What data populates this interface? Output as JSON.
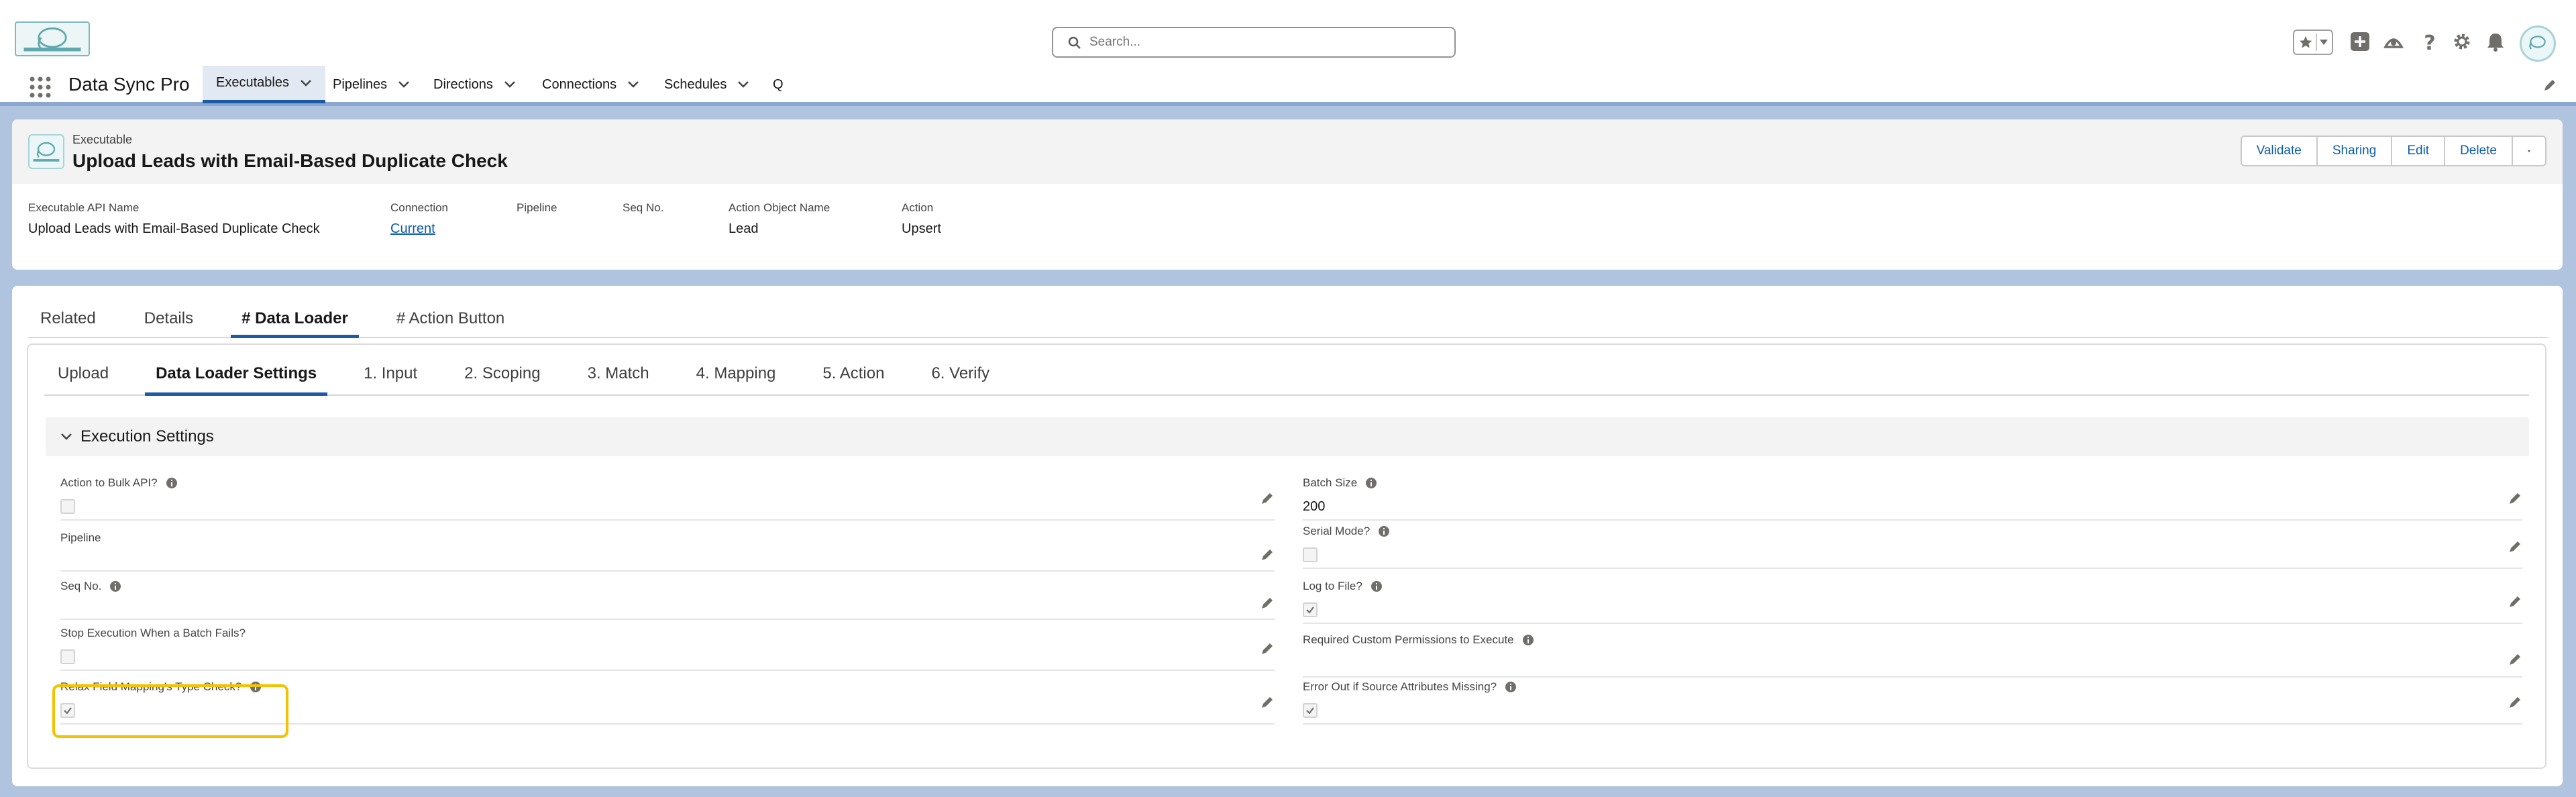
{
  "global_header": {
    "search_placeholder": "Search...",
    "icons": [
      "favorites-star-icon",
      "favorites-dropdown-icon",
      "add-icon",
      "trailhead-icon",
      "help-icon",
      "setup-gear-icon",
      "notifications-bell-icon",
      "avatar"
    ]
  },
  "app_nav": {
    "app_name": "Data Sync Pro",
    "tabs": [
      {
        "label": "Executables",
        "active": true
      },
      {
        "label": "Pipelines"
      },
      {
        "label": "Directions"
      },
      {
        "label": "Connections"
      },
      {
        "label": "Schedules"
      },
      {
        "label": "Q"
      }
    ]
  },
  "record": {
    "type": "Executable",
    "title": "Upload Leads with Email-Based Duplicate Check",
    "actions": [
      "Validate",
      "Sharing",
      "Edit",
      "Delete"
    ],
    "highlights": [
      {
        "label": "Executable API Name",
        "value": "Upload Leads with Email-Based Duplicate Check"
      },
      {
        "label": "Connection",
        "value": "Current"
      },
      {
        "label": "Pipeline",
        "value": ""
      },
      {
        "label": "Seq No.",
        "value": ""
      },
      {
        "label": "Action Object Name",
        "value": "Lead"
      },
      {
        "label": "Action",
        "value": "Upsert"
      }
    ]
  },
  "main_tabs": [
    {
      "label": "Related"
    },
    {
      "label": "Details"
    },
    {
      "label": "# Data Loader",
      "active": true
    },
    {
      "label": "# Action Button"
    }
  ],
  "sub_tabs": [
    {
      "label": "Upload"
    },
    {
      "label": "Data Loader Settings",
      "active": true
    },
    {
      "label": "1. Input"
    },
    {
      "label": "2. Scoping"
    },
    {
      "label": "3. Match"
    },
    {
      "label": "4. Mapping"
    },
    {
      "label": "5. Action"
    },
    {
      "label": "6. Verify"
    }
  ],
  "section": {
    "title": "Execution Settings",
    "left_fields": [
      {
        "label": "Action to Bulk API?",
        "info": true,
        "kind": "checkbox",
        "checked": false
      },
      {
        "label": "Pipeline",
        "info": false,
        "kind": "text",
        "value": ""
      },
      {
        "label": "Seq No.",
        "info": true,
        "kind": "text",
        "value": ""
      },
      {
        "label": "Stop Execution When a Batch Fails?",
        "info": false,
        "kind": "checkbox",
        "checked": false
      },
      {
        "label": "Relax Field Mapping's Type Check?",
        "info": true,
        "kind": "checkbox",
        "checked": true
      }
    ],
    "right_fields": [
      {
        "label": "Batch Size",
        "info": true,
        "kind": "text",
        "value": "200"
      },
      {
        "label": "Serial Mode?",
        "info": true,
        "kind": "checkbox",
        "checked": false
      },
      {
        "label": "Log to File?",
        "info": true,
        "kind": "checkbox",
        "checked": true
      },
      {
        "label": "Required Custom Permissions to Execute",
        "info": true,
        "kind": "text",
        "value": ""
      },
      {
        "label": "Error Out if Source Attributes Missing?",
        "info": true,
        "kind": "checkbox",
        "checked": true
      }
    ]
  },
  "colors": {
    "brand_blue": "#1b5aa6",
    "link_blue": "#0b5cab",
    "highlight_yellow": "#f3c200",
    "page_background": "#b0c4df"
  }
}
